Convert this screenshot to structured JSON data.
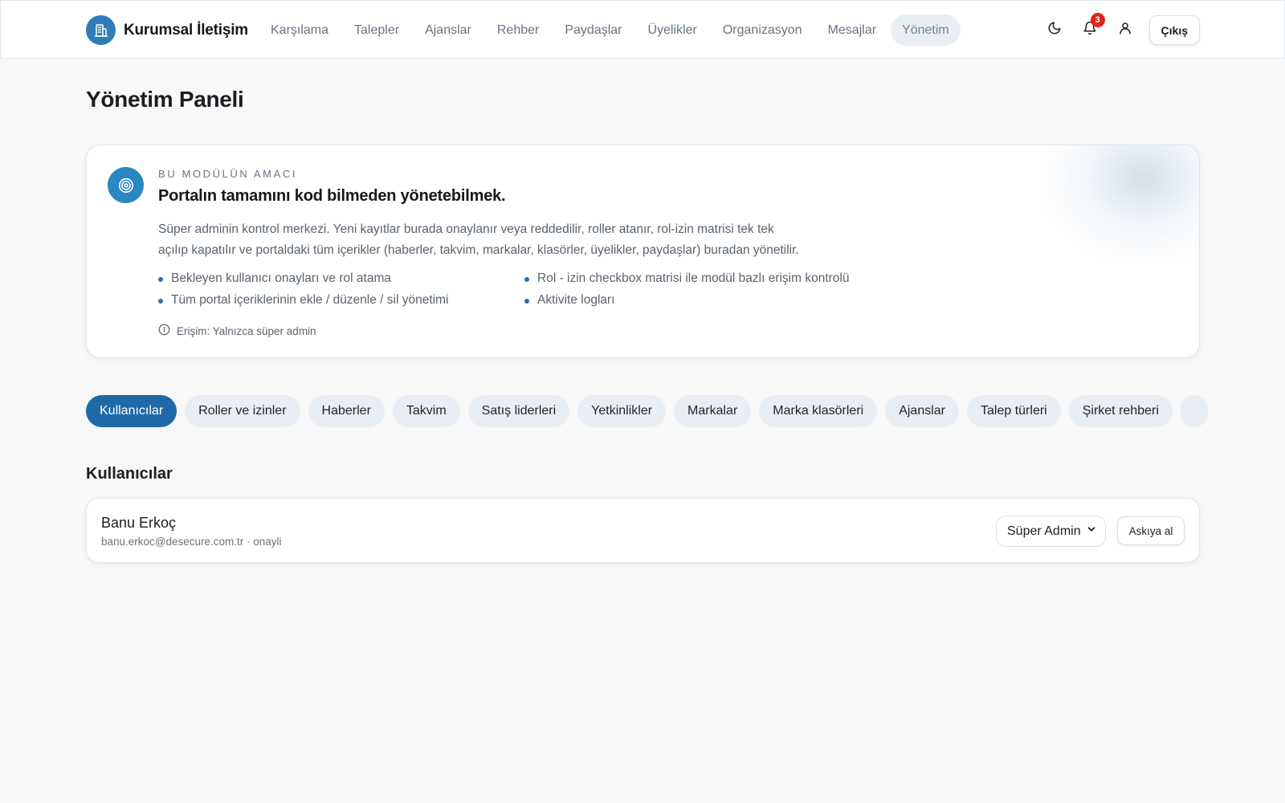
{
  "brand": {
    "name": "Kurumsal İletişim",
    "logo_icon": "building-icon"
  },
  "nav": {
    "items": [
      {
        "label": "Karşılama",
        "active": false
      },
      {
        "label": "Talepler",
        "active": false
      },
      {
        "label": "Ajanslar",
        "active": false
      },
      {
        "label": "Rehber",
        "active": false
      },
      {
        "label": "Paydaşlar",
        "active": false
      },
      {
        "label": "Üyelikler",
        "active": false
      },
      {
        "label": "Organizasyon",
        "active": false
      },
      {
        "label": "Mesajlar",
        "active": false
      },
      {
        "label": "Yönetim",
        "active": true
      }
    ]
  },
  "header_actions": {
    "theme_icon": "moon-icon",
    "notifications_icon": "bell-icon",
    "notification_count": "3",
    "profile_icon": "user-icon",
    "logout_label": "Çıkış"
  },
  "page": {
    "title": "Yönetim Paneli"
  },
  "info": {
    "icon": "target-icon",
    "eyebrow": "BU MODÜLÜN AMACI",
    "heading": "Portalın tamamını kod bilmeden yönetebilmek.",
    "description_line1": "Süper adminin kontrol merkezi. Yeni kayıtlar burada onaylanır veya reddedilir, roller atanır, rol-izin matrisi tek tek",
    "description_line2": "açılıp kapatılır ve portaldaki tüm içerikler (haberler, takvim, markalar, klasörler, üyelikler, paydaşlar) buradan yönetilir.",
    "bullets": [
      "Bekleyen kullanıcı onayları ve rol atama",
      "Rol - izin checkbox matrisi ile modül bazlı erişim kontrolü",
      "Tüm portal içeriklerinin ekle / düzenle / sil yönetimi",
      "Aktivite logları"
    ],
    "access_icon": "info-icon",
    "access_note": "Erişim: Yalnızca süper admin"
  },
  "tabs": [
    {
      "label": "Kullanıcılar",
      "active": true
    },
    {
      "label": "Roller ve izinler",
      "active": false
    },
    {
      "label": "Haberler",
      "active": false
    },
    {
      "label": "Takvim",
      "active": false
    },
    {
      "label": "Satış liderleri",
      "active": false
    },
    {
      "label": "Yetkinlikler",
      "active": false
    },
    {
      "label": "Markalar",
      "active": false
    },
    {
      "label": "Marka klasörleri",
      "active": false
    },
    {
      "label": "Ajanslar",
      "active": false
    },
    {
      "label": "Talep türleri",
      "active": false
    },
    {
      "label": "Şirket rehberi",
      "active": false
    },
    {
      "label": "",
      "active": false
    }
  ],
  "users_section": {
    "title": "Kullanıcılar",
    "users": [
      {
        "name": "Banu Erkoç",
        "email": "banu.erkoc@desecure.com.tr",
        "status": "onayli",
        "meta": "banu.erkoc@desecure.com.tr · onayli",
        "role": "Süper Admin",
        "action_label": "Askıya al"
      }
    ]
  },
  "colors": {
    "accent": "#1f69a8",
    "brand_logo": "#2e7db8",
    "badge": "#e1251b",
    "tab_bg": "#e9eef4",
    "page_bg": "#f7f8f7"
  }
}
